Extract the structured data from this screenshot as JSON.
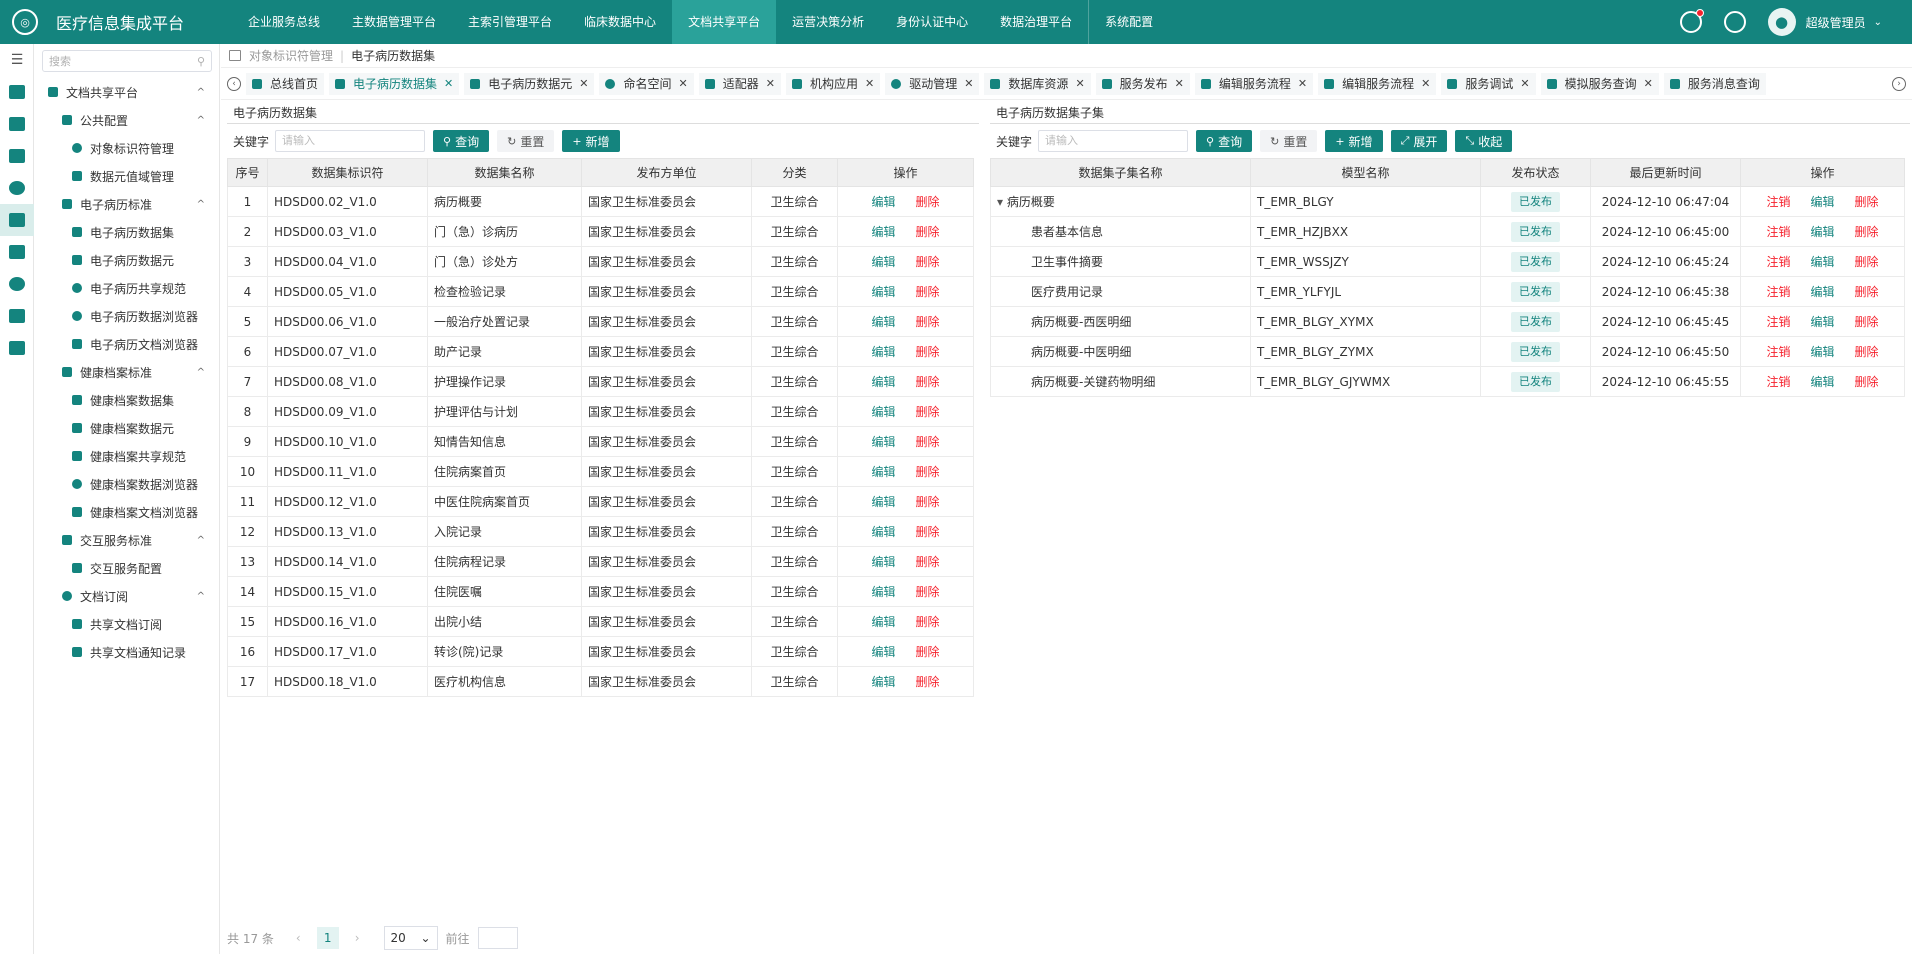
{
  "app": {
    "title": "医疗信息集成平台",
    "logo_text": "◎"
  },
  "topnav": [
    {
      "label": "企业服务总线",
      "active": false
    },
    {
      "label": "主数据管理平台",
      "active": false
    },
    {
      "label": "主索引管理平台",
      "active": false
    },
    {
      "label": "临床数据中心",
      "active": false
    },
    {
      "label": "文档共享平台",
      "active": true
    },
    {
      "label": "运营决策分析",
      "active": false
    },
    {
      "label": "身份认证中心",
      "active": false
    },
    {
      "label": "数据治理平台",
      "active": false
    },
    {
      "label": "系统配置",
      "active": false
    }
  ],
  "user": {
    "name": "超级管理员",
    "avatar_icon": "user-icon"
  },
  "sidebar": {
    "search_placeholder": "搜索",
    "items": [
      {
        "label": "文档共享平台",
        "level": 1,
        "caret": "^",
        "icon": "shield-icon"
      },
      {
        "label": "公共配置",
        "level": 2,
        "caret": "^",
        "icon": "config-icon"
      },
      {
        "label": "对象标识符管理",
        "level": 3,
        "icon": "circle-icon"
      },
      {
        "label": "数据元值域管理",
        "level": 3,
        "icon": "book-icon"
      },
      {
        "label": "电子病历标准",
        "level": 2,
        "caret": "^",
        "icon": "gear-icon"
      },
      {
        "label": "电子病历数据集",
        "level": 3,
        "icon": "file-icon"
      },
      {
        "label": "电子病历数据元",
        "level": 3,
        "icon": "calendar-icon"
      },
      {
        "label": "电子病历共享规范",
        "level": 3,
        "icon": "circle-icon"
      },
      {
        "label": "电子病历数据浏览器",
        "level": 3,
        "icon": "circle-icon"
      },
      {
        "label": "电子病历文档浏览器",
        "level": 3,
        "icon": "grid-icon"
      },
      {
        "label": "健康档案标准",
        "level": 2,
        "caret": "^",
        "icon": "chart-icon"
      },
      {
        "label": "健康档案数据集",
        "level": 3,
        "icon": "file-icon"
      },
      {
        "label": "健康档案数据元",
        "level": 3,
        "icon": "grid-icon"
      },
      {
        "label": "健康档案共享规范",
        "level": 3,
        "icon": "calendar-icon"
      },
      {
        "label": "健康档案数据浏览器",
        "level": 3,
        "icon": "circle-icon"
      },
      {
        "label": "健康档案文档浏览器",
        "level": 3,
        "icon": "database-icon"
      },
      {
        "label": "交互服务标准",
        "level": 2,
        "caret": "^",
        "icon": "config-icon"
      },
      {
        "label": "交互服务配置",
        "level": 3,
        "icon": "file-icon"
      },
      {
        "label": "文档订阅",
        "level": 2,
        "caret": "^",
        "icon": "circle-icon"
      },
      {
        "label": "共享文档订阅",
        "level": 3,
        "icon": "bookmark-icon"
      },
      {
        "label": "共享文档通知记录",
        "level": 3,
        "icon": "chart-icon"
      }
    ]
  },
  "breadcrumb": [
    "对象标识符管理",
    "电子病历数据集"
  ],
  "tabs": [
    {
      "label": "总线首页",
      "closable": false,
      "active": false
    },
    {
      "label": "电子病历数据集",
      "closable": true,
      "active": true
    },
    {
      "label": "电子病历数据元",
      "closable": true,
      "active": false
    },
    {
      "label": "命名空间",
      "closable": true,
      "active": false
    },
    {
      "label": "适配器",
      "closable": true,
      "active": false
    },
    {
      "label": "机构应用",
      "closable": true,
      "active": false
    },
    {
      "label": "驱动管理",
      "closable": true,
      "active": false
    },
    {
      "label": "数据库资源",
      "closable": true,
      "active": false
    },
    {
      "label": "服务发布",
      "closable": true,
      "active": false
    },
    {
      "label": "编辑服务流程",
      "closable": true,
      "active": false
    },
    {
      "label": "编辑服务流程",
      "closable": true,
      "active": false
    },
    {
      "label": "服务调试",
      "closable": true,
      "active": false
    },
    {
      "label": "模拟服务查询",
      "closable": true,
      "active": false
    },
    {
      "label": "服务消息查询",
      "closable": false,
      "active": false
    }
  ],
  "left_panel": {
    "title": "电子病历数据集",
    "keyword_label": "关键字",
    "keyword_placeholder": "请输入",
    "btn_query": "查询",
    "btn_reset": "重置",
    "btn_add": "新增",
    "columns": [
      "序号",
      "数据集标识符",
      "数据集名称",
      "发布方单位",
      "分类",
      "操作"
    ],
    "rows": [
      [
        "1",
        "HDSD00.02_V1.0",
        "病历概要",
        "国家卫生标准委员会",
        "卫生综合"
      ],
      [
        "2",
        "HDSD00.03_V1.0",
        "门（急）诊病历",
        "国家卫生标准委员会",
        "卫生综合"
      ],
      [
        "3",
        "HDSD00.04_V1.0",
        "门（急）诊处方",
        "国家卫生标准委员会",
        "卫生综合"
      ],
      [
        "4",
        "HDSD00.05_V1.0",
        "检查检验记录",
        "国家卫生标准委员会",
        "卫生综合"
      ],
      [
        "5",
        "HDSD00.06_V1.0",
        "一般治疗处置记录",
        "国家卫生标准委员会",
        "卫生综合"
      ],
      [
        "6",
        "HDSD00.07_V1.0",
        "助产记录",
        "国家卫生标准委员会",
        "卫生综合"
      ],
      [
        "7",
        "HDSD00.08_V1.0",
        "护理操作记录",
        "国家卫生标准委员会",
        "卫生综合"
      ],
      [
        "8",
        "HDSD00.09_V1.0",
        "护理评估与计划",
        "国家卫生标准委员会",
        "卫生综合"
      ],
      [
        "9",
        "HDSD00.10_V1.0",
        "知情告知信息",
        "国家卫生标准委员会",
        "卫生综合"
      ],
      [
        "10",
        "HDSD00.11_V1.0",
        "住院病案首页",
        "国家卫生标准委员会",
        "卫生综合"
      ],
      [
        "11",
        "HDSD00.12_V1.0",
        "中医住院病案首页",
        "国家卫生标准委员会",
        "卫生综合"
      ],
      [
        "12",
        "HDSD00.13_V1.0",
        "入院记录",
        "国家卫生标准委员会",
        "卫生综合"
      ],
      [
        "13",
        "HDSD00.14_V1.0",
        "住院病程记录",
        "国家卫生标准委员会",
        "卫生综合"
      ],
      [
        "14",
        "HDSD00.15_V1.0",
        "住院医嘱",
        "国家卫生标准委员会",
        "卫生综合"
      ],
      [
        "15",
        "HDSD00.16_V1.0",
        "出院小结",
        "国家卫生标准委员会",
        "卫生综合"
      ],
      [
        "16",
        "HDSD00.17_V1.0",
        "转诊(院)记录",
        "国家卫生标准委员会",
        "卫生综合"
      ],
      [
        "17",
        "HDSD00.18_V1.0",
        "医疗机构信息",
        "国家卫生标准委员会",
        "卫生综合"
      ]
    ],
    "action_edit": "编辑",
    "action_delete": "删除"
  },
  "right_panel": {
    "title": "电子病历数据集子集",
    "keyword_label": "关键字",
    "keyword_placeholder": "请输入",
    "btn_query": "查询",
    "btn_reset": "重置",
    "btn_add": "新增",
    "btn_expand": "展开",
    "btn_collapse": "收起",
    "columns": [
      "数据集子集名称",
      "模型名称",
      "发布状态",
      "最后更新时间",
      "操作"
    ],
    "rows": [
      {
        "name": "病历概要",
        "model": "T_EMR_BLGY",
        "status": "已发布",
        "time": "2024-12-10 06:47:04",
        "parent": true
      },
      {
        "name": "患者基本信息",
        "model": "T_EMR_HZJBXX",
        "status": "已发布",
        "time": "2024-12-10 06:45:00",
        "parent": false
      },
      {
        "name": "卫生事件摘要",
        "model": "T_EMR_WSSJZY",
        "status": "已发布",
        "time": "2024-12-10 06:45:24",
        "parent": false
      },
      {
        "name": "医疗费用记录",
        "model": "T_EMR_YLFYJL",
        "status": "已发布",
        "time": "2024-12-10 06:45:38",
        "parent": false
      },
      {
        "name": "病历概要-西医明细",
        "model": "T_EMR_BLGY_XYMX",
        "status": "已发布",
        "time": "2024-12-10 06:45:45",
        "parent": false
      },
      {
        "name": "病历概要-中医明细",
        "model": "T_EMR_BLGY_ZYMX",
        "status": "已发布",
        "time": "2024-12-10 06:45:50",
        "parent": false
      },
      {
        "name": "病历概要-关键药物明细",
        "model": "T_EMR_BLGY_GJYWMX",
        "status": "已发布",
        "time": "2024-12-10 06:45:55",
        "parent": false
      }
    ],
    "action_cancel": "注销",
    "action_edit": "编辑",
    "action_delete": "删除"
  },
  "pager": {
    "total_text": "共 17 条",
    "current_page": "1",
    "page_size": "20",
    "goto_label": "前往"
  },
  "colors": {
    "primary": "#14847e",
    "danger": "#f5222d"
  }
}
